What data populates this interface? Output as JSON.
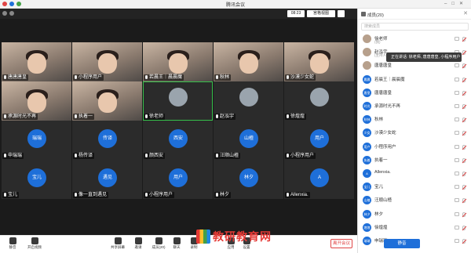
{
  "window": {
    "title": "腾讯会议"
  },
  "video_top": {
    "time": "08:23",
    "view_mode": "宫格视图"
  },
  "tiles": [
    {
      "label": "唐唐唐皇",
      "kind": "video"
    },
    {
      "label": "小程序用户",
      "kind": "video"
    },
    {
      "label": "若晨王｜晨晨魔",
      "kind": "video"
    },
    {
      "label": "秋林",
      "kind": "video"
    },
    {
      "label": "沙漠少女蛇",
      "kind": "video"
    },
    {
      "label": "承源时光不再",
      "kind": "video"
    },
    {
      "label": "执着一",
      "kind": "video"
    },
    {
      "label": "徐老师",
      "kind": "dark"
    },
    {
      "label": "赵泓宇",
      "kind": "dark"
    },
    {
      "label": "徐煌煌",
      "kind": "dark"
    },
    {
      "label": "申瑞瑞",
      "kind": "avatar",
      "avatar_text": "瑞瑞"
    },
    {
      "label": "杨传译",
      "kind": "avatar",
      "avatar_text": "传译"
    },
    {
      "label": "颜西安",
      "kind": "avatar",
      "avatar_text": "西安"
    },
    {
      "label": "汪顺山楂",
      "kind": "avatar",
      "avatar_text": "山楂"
    },
    {
      "label": "小程序用户",
      "kind": "avatar",
      "avatar_text": "用户"
    },
    {
      "label": "宝儿",
      "kind": "avatar",
      "avatar_text": "宝儿"
    },
    {
      "label": "像一直到遇见",
      "kind": "avatar",
      "avatar_text": "遇见"
    },
    {
      "label": "小程序用户",
      "kind": "avatar",
      "avatar_text": "用户"
    },
    {
      "label": "林夕",
      "kind": "avatar",
      "avatar_text": "林夕"
    },
    {
      "label": "Allenxia.",
      "kind": "avatar",
      "avatar_text": "A"
    }
  ],
  "toolbar": {
    "items": [
      {
        "label": "静音",
        "icon": "mic-icon"
      },
      {
        "label": "开启视频",
        "icon": "camera-icon"
      },
      {
        "label": "共享屏幕",
        "icon": "screen-share-icon"
      },
      {
        "label": "邀请",
        "icon": "invite-icon"
      },
      {
        "label": "成员(20)",
        "icon": "members-icon"
      },
      {
        "label": "聊天",
        "icon": "chat-icon"
      },
      {
        "label": "录制",
        "icon": "record-icon"
      },
      {
        "label": "应用",
        "icon": "apps-icon"
      },
      {
        "label": "设置",
        "icon": "settings-icon"
      }
    ],
    "leave_label": "离开会议"
  },
  "watermark": "教研教育网",
  "panel": {
    "title": "成员(20)",
    "search_placeholder": "搜索成员",
    "speaking": "正在讲话: 徐老师, 唐唐唐皇, 小程序用户",
    "members": [
      {
        "name": "徐老师",
        "sub": "(我)",
        "avatar": "photo"
      },
      {
        "name": "赵泓宇",
        "sub": "(主持人)",
        "avatar": "photo"
      },
      {
        "name": "唐唐唐皇",
        "sub": "",
        "avatar": "photo"
      },
      {
        "name": "若晨王｜晨晨魔",
        "sub": "",
        "avatar": "晨晨"
      },
      {
        "name": "唐唐唐皇",
        "sub": "",
        "avatar": "唐皇"
      },
      {
        "name": "承源时光不再",
        "sub": "",
        "avatar": "时光"
      },
      {
        "name": "秋林",
        "sub": "",
        "avatar": "秋林"
      },
      {
        "name": "沙漠少女蛇",
        "sub": "",
        "avatar": "少女"
      },
      {
        "name": "小程序用户",
        "sub": "",
        "avatar": "用户"
      },
      {
        "name": "执着一",
        "sub": "",
        "avatar": "执着"
      },
      {
        "name": "Allenxia.",
        "sub": "",
        "avatar": "A"
      },
      {
        "name": "宝儿",
        "sub": "",
        "avatar": "宝儿"
      },
      {
        "name": "汪顺山楂",
        "sub": "",
        "avatar": "山楂"
      },
      {
        "name": "林夕",
        "sub": "",
        "avatar": "林夕"
      },
      {
        "name": "徐煌煌",
        "sub": "",
        "avatar": "煌煌"
      },
      {
        "name": "申瑞瑞",
        "sub": "",
        "avatar": "瑞瑞"
      }
    ],
    "mute_all_label": "静音"
  },
  "colors": {
    "accent": "#1e6fd9",
    "danger": "#e04545",
    "dark": "#1b1b1b"
  }
}
